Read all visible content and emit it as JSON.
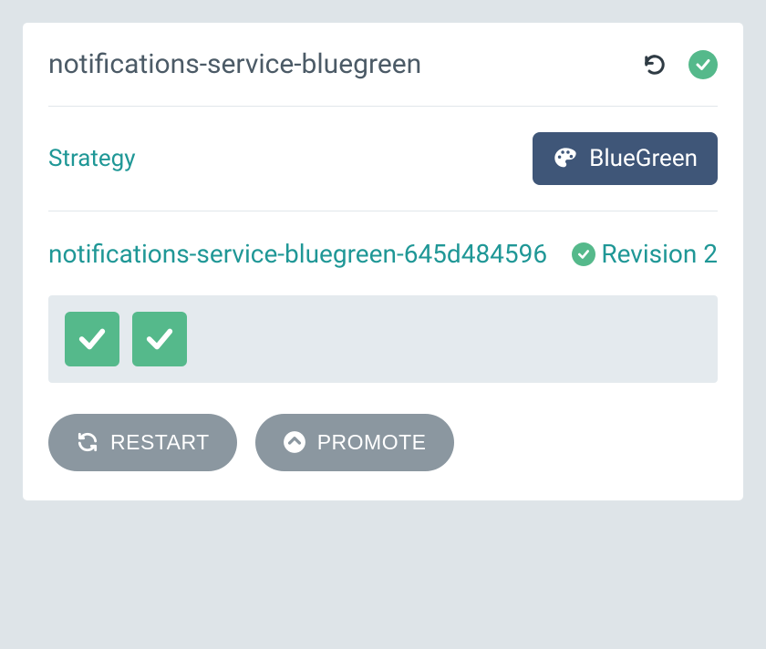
{
  "header": {
    "title": "notifications-service-bluegreen"
  },
  "strategy": {
    "label": "Strategy",
    "value": "BlueGreen"
  },
  "revision": {
    "name": "notifications-service-bluegreen-645d484596",
    "label": "Revision 2",
    "pods": 2
  },
  "actions": {
    "restart": "RESTART",
    "promote": "PROMOTE"
  }
}
